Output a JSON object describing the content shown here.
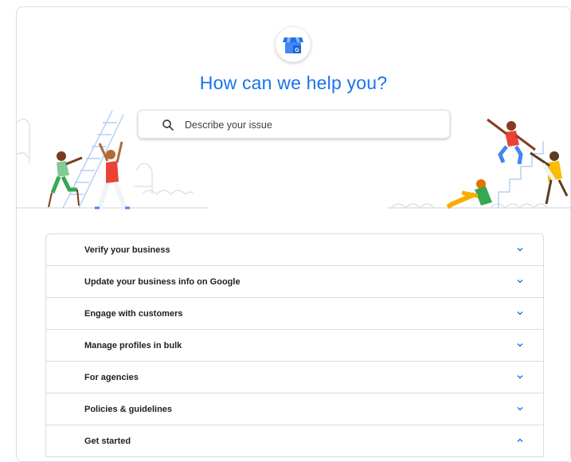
{
  "header": {
    "logo_icon": "google-my-business-store-icon",
    "logo_letter": "G",
    "title": "How can we help you?"
  },
  "search": {
    "placeholder": "Describe your issue",
    "icon": "search-icon"
  },
  "faq": {
    "items": [
      {
        "label": "Verify your business",
        "expanded": false
      },
      {
        "label": "Update your business info on Google",
        "expanded": false
      },
      {
        "label": "Engage with customers",
        "expanded": false
      },
      {
        "label": "Manage profiles in bulk",
        "expanded": false
      },
      {
        "label": "For agencies",
        "expanded": false
      },
      {
        "label": "Policies & guidelines",
        "expanded": false
      },
      {
        "label": "Get started",
        "expanded": true
      }
    ]
  },
  "colors": {
    "accent": "#1a73e8",
    "border": "#dadce0"
  }
}
